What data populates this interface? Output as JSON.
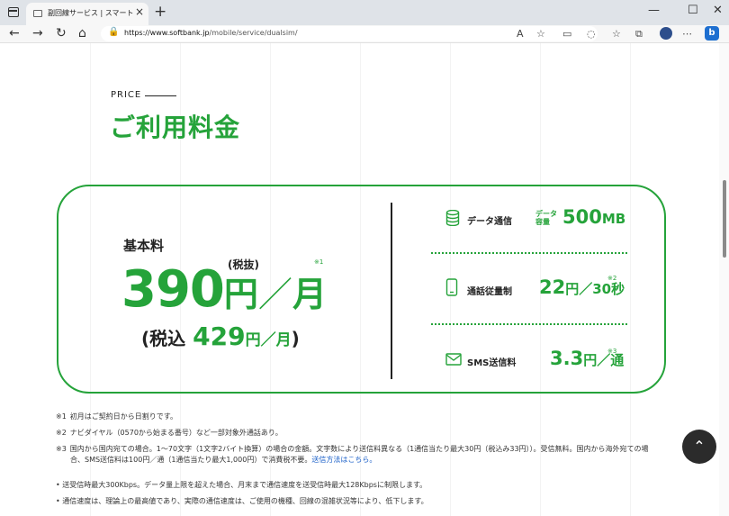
{
  "browser": {
    "tab_title": "副回線サービス | スマートフォン・携帯電話",
    "url_host": "https://www.softbank.jp",
    "url_path": "/mobile/service/dualsim/",
    "new_tab": "+",
    "tab_close": "×"
  },
  "section": {
    "eyebrow": "PRICE",
    "title": "ご利用料金"
  },
  "base": {
    "label": "基本料",
    "tax_excluded": "(税抜)",
    "note_ref": "※1",
    "price_number": "390",
    "price_yen": "円",
    "price_slash": "／",
    "price_unit": "月",
    "tax_included_prefix": "(税込",
    "tax_included_number": "429",
    "tax_included_unit": "円／月",
    "tax_included_close": ")"
  },
  "features": [
    {
      "icon": "database-icon",
      "label": "データ通信",
      "sub": "データ容量",
      "value": "500",
      "unit": "MB",
      "note": ""
    },
    {
      "icon": "phone-icon",
      "label": "通話従量制",
      "value": "22",
      "unit": "円／30秒",
      "note": "※2"
    },
    {
      "icon": "mail-icon",
      "label": "SMS送信料",
      "value": "3.3",
      "unit": "円／通",
      "note": "※3"
    }
  ],
  "notes": [
    {
      "mark": "※1",
      "text": "初月はご契約日から日割りです。"
    },
    {
      "mark": "※2",
      "text": "ナビダイヤル（0570から始まる番号）など一部対象外通話あり。"
    },
    {
      "mark": "※3",
      "text": "国内から国内宛ての場合。1〜70文字（1文字2バイト換算）の場合の金額。文字数により送信料異なる（1通信当たり最大30円（税込み33円））。受信無料。国内から海外宛ての場",
      "text2": "合、SMS送信料は100円／通（1通信当たり最大1,000円）で消費税不要。",
      "link": "送信方法はこちら。"
    }
  ],
  "bullets": [
    "送受信時最大300Kbps。データ量上限を超えた場合、月末まで通信速度を送受信時最大128Kbpsに制限します。",
    "通信速度は、理論上の最高値であり、実際の通信速度は、ご使用の機種、回線の混雑状況等により、低下します。"
  ],
  "colors": {
    "accent": "#25a33a",
    "link": "#1a5fc8"
  }
}
